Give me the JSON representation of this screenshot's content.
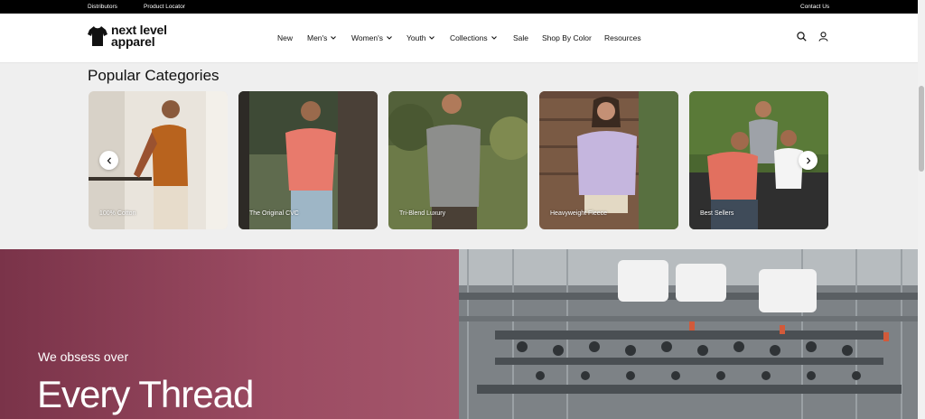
{
  "topbar": {
    "distributors": "Distributors",
    "product_locator": "Product Locator",
    "contact": "Contact Us"
  },
  "logo": {
    "line1": "next level",
    "line2": "apparel"
  },
  "nav": {
    "new": "New",
    "mens": "Men's",
    "womens": "Women's",
    "youth": "Youth",
    "collections": "Collections",
    "sale": "Sale",
    "shop_by_color": "Shop By Color",
    "resources": "Resources"
  },
  "categories": {
    "title": "Popular Categories",
    "items": [
      {
        "label": "100% Cotton"
      },
      {
        "label": "The Original CVC"
      },
      {
        "label": "Tri-Blend Luxury"
      },
      {
        "label": "Heavyweight Fleece"
      },
      {
        "label": "Best Sellers"
      }
    ]
  },
  "promo": {
    "eyebrow": "We obsess over",
    "headline": "Every Thread"
  },
  "colors": {
    "promo_bg": "#9b4b62",
    "topbar_bg": "#000000"
  }
}
